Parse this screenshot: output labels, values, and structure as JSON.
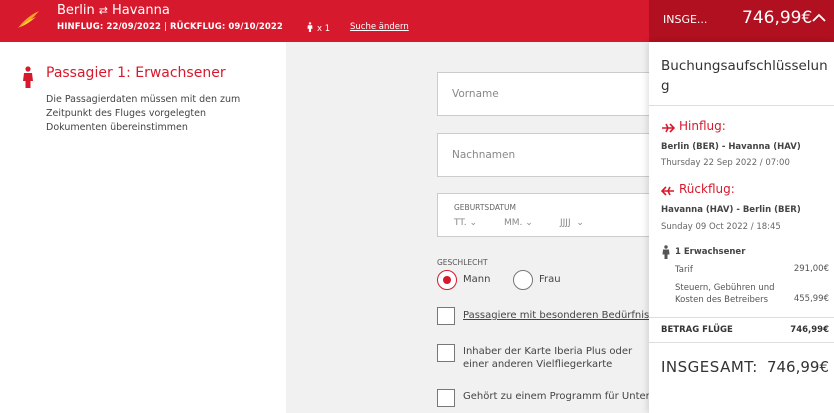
{
  "header": {
    "origin": "Berlin",
    "destination": "Havanna",
    "outbound": "HINFLUG: 22/09/2022",
    "return": "RÜCKFLUG: 09/10/2022",
    "passenger_count": "x 1",
    "change_search": "Suche ändern",
    "total_label": "INSGE...",
    "total_amount": "746,99€"
  },
  "passenger": {
    "title": "Passagier 1: Erwachsener",
    "description": "Die Passagierdaten müssen mit den zum Zeitpunkt des Fluges vorgelegten Dokumenten übereinstimmen"
  },
  "form": {
    "first_name_placeholder": "Vorname",
    "last_name_placeholder": "Nachnamen",
    "dob_label": "GEBURTSDATUM",
    "day": "TT.",
    "month": "MM.",
    "year": "JJJJ",
    "gender_label": "GESCHLECHT",
    "male": "Mann",
    "female": "Frau",
    "selected_gender": "Mann",
    "special_needs": "Passagiere mit besonderen Bedürfnissen",
    "iberia_plus": "Inhaber der Karte Iberia Plus oder einer anderen Vielfliegerkarte",
    "company_program": "Gehört zu einem Programm für Unternehmen"
  },
  "summary": {
    "title": "Buchungsaufschlüsselung",
    "outbound": {
      "label": "Hinflug:",
      "route": "Berlin (BER) - Havanna (HAV)",
      "date": "Thursday 22 Sep 2022 / 07:00"
    },
    "return": {
      "label": "Rückflug:",
      "route": "Havanna (HAV) - Berlin (BER)",
      "date": "Sunday 09 Oct 2022 / 18:45"
    },
    "adults": "1 Erwachsener",
    "fare_label": "Tarif",
    "fare_value": "291,00€",
    "taxes_label": "Steuern, Gebühren und Kosten des Betreibers",
    "taxes_value": "455,99€",
    "flights_total_label": "BETRAG FLÜGE",
    "flights_total_value": "746,99€",
    "grand_total_label": "INSGESAMT:",
    "grand_total_value": "746,99€"
  },
  "colors": {
    "brand_red": "#d7192d",
    "dark_red": "#b0101f"
  }
}
